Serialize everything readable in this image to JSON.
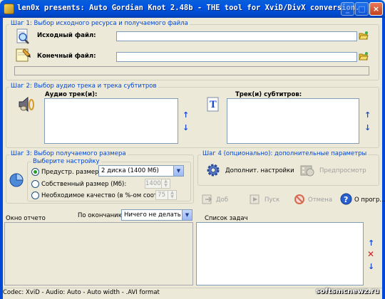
{
  "window": {
    "title": "len0x presents: Auto Gordian Knot 2.48b - THE tool for XviD/DivX conversion.",
    "minimize": "_",
    "maximize": "□",
    "close": "×"
  },
  "step1": {
    "legend": "Шаг 1: Выбор исходного ресурса и получаемого файла",
    "source_label": "Исходный файл:",
    "source_value": "",
    "target_label": "Конечный файл:",
    "target_value": ""
  },
  "step2": {
    "legend": "Шаг 2: Выбор аудио трека и трека субтитров",
    "audio_label": "Аудио трек(и):",
    "subtitle_label": "Трек(и) субтитров:",
    "up_arrow": "↑",
    "down_arrow": "↓"
  },
  "step3": {
    "legend": "Шаг 3: Выбор получаемого размера",
    "setting_legend": "Выберите настройку",
    "opt_preset": "Предустр. размер:",
    "preset_value": "2 диска (1400 Мб)",
    "opt_custom": "Собственный размер (Мб):",
    "custom_value": "1400",
    "opt_quality": "Необходимое качество (в %-ом соотнош.):",
    "quality_value": "75"
  },
  "step4": {
    "legend": "Шаг 4 (опционально): дополнительные параметры",
    "advanced_settings": "Дополнит. настройки",
    "preview": "Предпросмотр"
  },
  "actions": {
    "add": "Доб",
    "start": "Пуск",
    "cancel": "Отмена",
    "about": "О прогр..."
  },
  "output": {
    "window_label": "Окно отчето",
    "on_finish_label": "По окончанию",
    "on_finish_value": "Ничего не делать"
  },
  "jobs": {
    "label": "Список задач",
    "delete": "✕"
  },
  "status": {
    "text": "Codec: XviD - Audio: Auto - Auto width - .AVI format",
    "watermark": "softsmcnewz.ru"
  },
  "colors": {
    "title_bar": "#0054e3",
    "legend_text": "#0046d5",
    "window_bg": "#ece9d8",
    "arrow": "#1c4ccf"
  }
}
